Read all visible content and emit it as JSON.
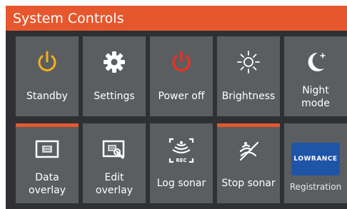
{
  "window": {
    "title": "System Controls"
  },
  "colors": {
    "accent": "#e6572d",
    "tile": "#5b5e61",
    "background": "#2f3033",
    "standby_icon": "#f3b21b",
    "power_icon": "#ff2a1a",
    "brand": "#1f55a6"
  },
  "tiles": [
    {
      "label": "Standby",
      "icon": "standby-icon",
      "active": false
    },
    {
      "label": "Settings",
      "icon": "gear-icon",
      "active": false
    },
    {
      "label": "Power off",
      "icon": "power-icon",
      "active": false
    },
    {
      "label": "Brightness",
      "icon": "brightness-icon",
      "active": false
    },
    {
      "label_lines": [
        "Night",
        "mode"
      ],
      "icon": "night-mode-icon",
      "active": false
    },
    {
      "label_lines": [
        "Data",
        "overlay"
      ],
      "icon": "data-overlay-icon",
      "active": true
    },
    {
      "label_lines": [
        "Edit",
        "overlay"
      ],
      "icon": "edit-overlay-icon",
      "active": false
    },
    {
      "label": "Log sonar",
      "icon": "log-sonar-icon",
      "icon_text": "REC",
      "active": false
    },
    {
      "label": "Stop sonar",
      "icon": "stop-sonar-icon",
      "active": true
    },
    {
      "label": "Registration",
      "icon": "lowrance-logo",
      "logo_text": "LOWRANCE",
      "active": false
    }
  ]
}
